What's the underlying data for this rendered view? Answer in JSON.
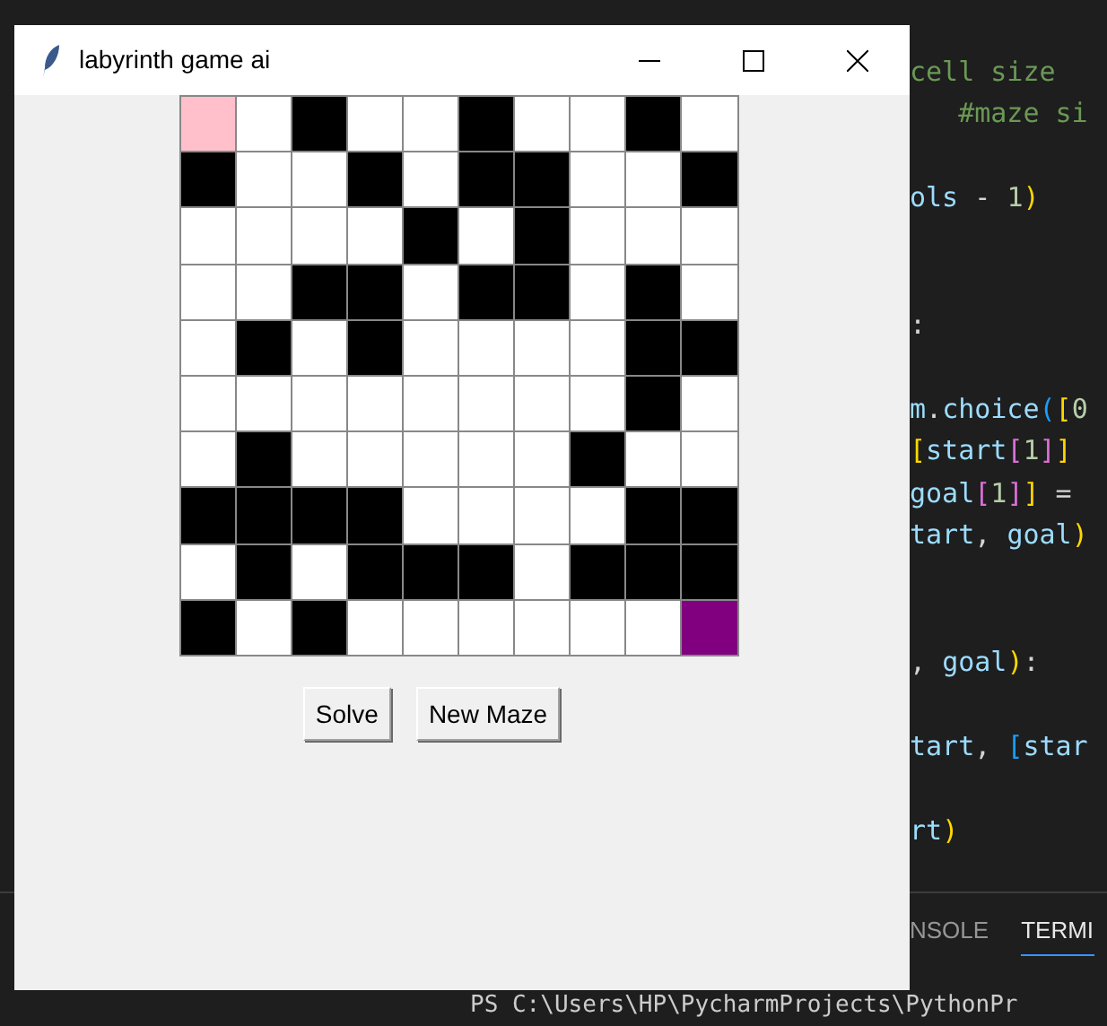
{
  "editor": {
    "code_lines": [
      {
        "kind": "code",
        "tokens": [
          {
            "kind": "comment",
            "text": "cell size"
          }
        ]
      },
      {
        "kind": "code",
        "tokens": [
          {
            "kind": "comment",
            "text": "   #maze si"
          }
        ]
      },
      {
        "kind": "blank"
      },
      {
        "kind": "code",
        "tokens": [
          {
            "kind": "ident",
            "text": "ols"
          },
          {
            "kind": "plain",
            "text": " - "
          },
          {
            "kind": "number",
            "text": "1"
          },
          {
            "kind": "bracket1",
            "text": ")"
          }
        ]
      },
      {
        "kind": "blank"
      },
      {
        "kind": "blank"
      },
      {
        "kind": "code",
        "tokens": [
          {
            "kind": "plain",
            "text": ":"
          }
        ]
      },
      {
        "kind": "blank"
      },
      {
        "kind": "code",
        "tokens": [
          {
            "kind": "ident",
            "text": "m"
          },
          {
            "kind": "plain",
            "text": "."
          },
          {
            "kind": "ident",
            "text": "choice"
          },
          {
            "kind": "bracket3",
            "text": "("
          },
          {
            "kind": "bracket1",
            "text": "["
          },
          {
            "kind": "number",
            "text": "0"
          }
        ]
      },
      {
        "kind": "code",
        "tokens": [
          {
            "kind": "bracket1",
            "text": "["
          },
          {
            "kind": "ident",
            "text": "start"
          },
          {
            "kind": "bracket2",
            "text": "["
          },
          {
            "kind": "number",
            "text": "1"
          },
          {
            "kind": "bracket2",
            "text": "]"
          },
          {
            "kind": "bracket1",
            "text": "]"
          }
        ]
      },
      {
        "kind": "code",
        "tokens": [
          {
            "kind": "ident",
            "text": "goal"
          },
          {
            "kind": "bracket2",
            "text": "["
          },
          {
            "kind": "number",
            "text": "1"
          },
          {
            "kind": "bracket2",
            "text": "]"
          },
          {
            "kind": "bracket1",
            "text": "]"
          },
          {
            "kind": "plain",
            "text": " ="
          }
        ]
      },
      {
        "kind": "code",
        "tokens": [
          {
            "kind": "ident",
            "text": "tart"
          },
          {
            "kind": "plain",
            "text": ", "
          },
          {
            "kind": "ident",
            "text": "goal"
          },
          {
            "kind": "bracket1",
            "text": ")"
          }
        ]
      },
      {
        "kind": "blank"
      },
      {
        "kind": "blank"
      },
      {
        "kind": "code",
        "tokens": [
          {
            "kind": "plain",
            "text": ", "
          },
          {
            "kind": "ident",
            "text": "goal"
          },
          {
            "kind": "bracket1",
            "text": ")"
          },
          {
            "kind": "plain",
            "text": ":"
          }
        ]
      },
      {
        "kind": "blank"
      },
      {
        "kind": "code",
        "tokens": [
          {
            "kind": "ident",
            "text": "tart"
          },
          {
            "kind": "plain",
            "text": ", "
          },
          {
            "kind": "bracket3",
            "text": "["
          },
          {
            "kind": "ident",
            "text": "star"
          }
        ]
      },
      {
        "kind": "blank"
      },
      {
        "kind": "code",
        "tokens": [
          {
            "kind": "ident",
            "text": "rt"
          },
          {
            "kind": "bracket1",
            "text": ")"
          }
        ]
      }
    ],
    "panel_tabs": [
      {
        "label": "NSOLE",
        "selected": false
      },
      {
        "label": "TERMI",
        "selected": true
      }
    ],
    "terminal_line": "PS C:\\Users\\HP\\PycharmProjects\\PythonPr"
  },
  "window": {
    "title": "labyrinth game ai",
    "maze": [
      {
        "cells": [
          {
            "kind": "start"
          },
          {
            "kind": "open"
          },
          {
            "kind": "wall"
          },
          {
            "kind": "open"
          },
          {
            "kind": "open"
          },
          {
            "kind": "wall"
          },
          {
            "kind": "open"
          },
          {
            "kind": "open"
          },
          {
            "kind": "wall"
          },
          {
            "kind": "open"
          }
        ]
      },
      {
        "cells": [
          {
            "kind": "wall"
          },
          {
            "kind": "open"
          },
          {
            "kind": "open"
          },
          {
            "kind": "wall"
          },
          {
            "kind": "open"
          },
          {
            "kind": "wall"
          },
          {
            "kind": "wall"
          },
          {
            "kind": "open"
          },
          {
            "kind": "open"
          },
          {
            "kind": "wall"
          }
        ]
      },
      {
        "cells": [
          {
            "kind": "open"
          },
          {
            "kind": "open"
          },
          {
            "kind": "open"
          },
          {
            "kind": "open"
          },
          {
            "kind": "wall"
          },
          {
            "kind": "open"
          },
          {
            "kind": "wall"
          },
          {
            "kind": "open"
          },
          {
            "kind": "open"
          },
          {
            "kind": "open"
          }
        ]
      },
      {
        "cells": [
          {
            "kind": "open"
          },
          {
            "kind": "open"
          },
          {
            "kind": "wall"
          },
          {
            "kind": "wall"
          },
          {
            "kind": "open"
          },
          {
            "kind": "wall"
          },
          {
            "kind": "wall"
          },
          {
            "kind": "open"
          },
          {
            "kind": "wall"
          },
          {
            "kind": "open"
          }
        ]
      },
      {
        "cells": [
          {
            "kind": "open"
          },
          {
            "kind": "wall"
          },
          {
            "kind": "open"
          },
          {
            "kind": "wall"
          },
          {
            "kind": "open"
          },
          {
            "kind": "open"
          },
          {
            "kind": "open"
          },
          {
            "kind": "open"
          },
          {
            "kind": "wall"
          },
          {
            "kind": "wall"
          }
        ]
      },
      {
        "cells": [
          {
            "kind": "open"
          },
          {
            "kind": "open"
          },
          {
            "kind": "open"
          },
          {
            "kind": "open"
          },
          {
            "kind": "open"
          },
          {
            "kind": "open"
          },
          {
            "kind": "open"
          },
          {
            "kind": "open"
          },
          {
            "kind": "wall"
          },
          {
            "kind": "open"
          }
        ]
      },
      {
        "cells": [
          {
            "kind": "open"
          },
          {
            "kind": "wall"
          },
          {
            "kind": "open"
          },
          {
            "kind": "open"
          },
          {
            "kind": "open"
          },
          {
            "kind": "open"
          },
          {
            "kind": "open"
          },
          {
            "kind": "wall"
          },
          {
            "kind": "open"
          },
          {
            "kind": "open"
          }
        ]
      },
      {
        "cells": [
          {
            "kind": "wall"
          },
          {
            "kind": "wall"
          },
          {
            "kind": "wall"
          },
          {
            "kind": "wall"
          },
          {
            "kind": "open"
          },
          {
            "kind": "open"
          },
          {
            "kind": "open"
          },
          {
            "kind": "open"
          },
          {
            "kind": "wall"
          },
          {
            "kind": "wall"
          }
        ]
      },
      {
        "cells": [
          {
            "kind": "open"
          },
          {
            "kind": "wall"
          },
          {
            "kind": "open"
          },
          {
            "kind": "wall"
          },
          {
            "kind": "wall"
          },
          {
            "kind": "wall"
          },
          {
            "kind": "open"
          },
          {
            "kind": "wall"
          },
          {
            "kind": "wall"
          },
          {
            "kind": "wall"
          }
        ]
      },
      {
        "cells": [
          {
            "kind": "wall"
          },
          {
            "kind": "open"
          },
          {
            "kind": "wall"
          },
          {
            "kind": "open"
          },
          {
            "kind": "open"
          },
          {
            "kind": "open"
          },
          {
            "kind": "open"
          },
          {
            "kind": "open"
          },
          {
            "kind": "open"
          },
          {
            "kind": "goal"
          }
        ]
      }
    ],
    "buttons": [
      "Solve",
      "New Maze"
    ]
  }
}
